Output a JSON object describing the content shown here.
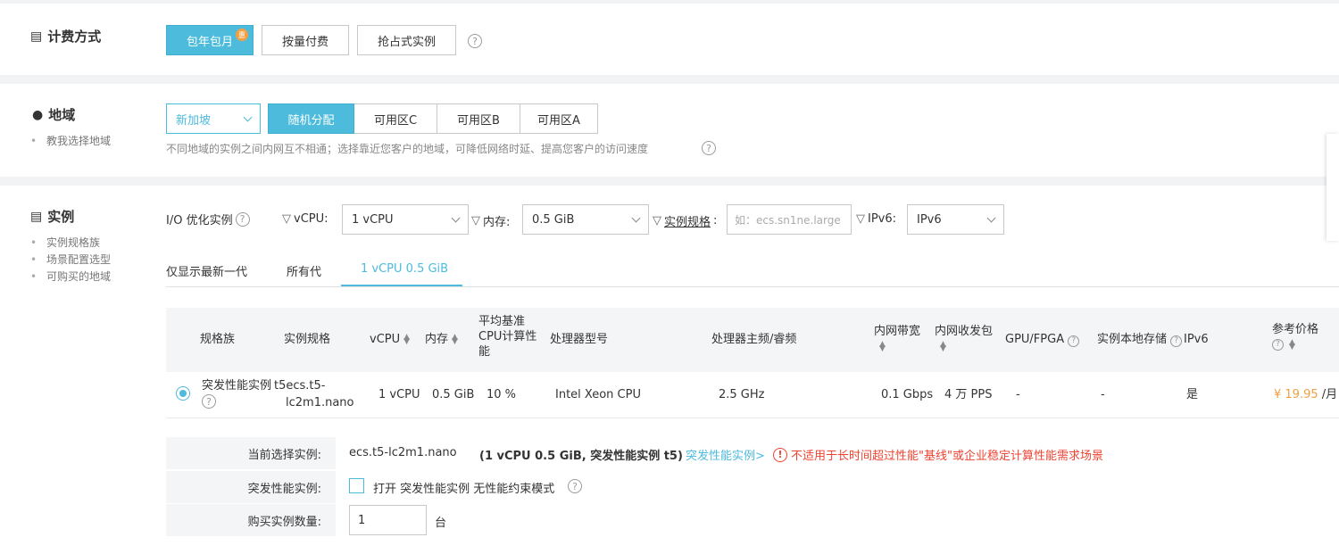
{
  "billing": {
    "title": "计费方式",
    "options": [
      "包年包月",
      "按量付费",
      "抢占式实例"
    ],
    "badge": "惠"
  },
  "region": {
    "title": "地域",
    "links": [
      "教我选择地域"
    ],
    "selected_region": "新加坡",
    "zones": [
      "随机分配",
      "可用区C",
      "可用区B",
      "可用区A"
    ],
    "hint": "不同地域的实例之间内网互不相通；选择靠近您客户的地域，可降低网络时延、提高您客户的访问速度"
  },
  "instance": {
    "title": "实例",
    "links": [
      "实例规格族",
      "场景配置选型",
      "可购买的地域"
    ],
    "io_label": "I/O 优化实例",
    "filters": {
      "vcpu_label": "vCPU:",
      "vcpu_value": "1 vCPU",
      "mem_label": "内存:",
      "mem_value": "0.5 GiB",
      "spec_label": "实例规格",
      "spec_placeholder": "如：ecs.sn1ne.large",
      "ipv6_label": "IPv6:",
      "ipv6_value": "IPv6"
    },
    "tabs": [
      "仅显示最新一代",
      "所有代",
      "1 vCPU 0.5 GiB"
    ],
    "columns": {
      "family": "规格族",
      "spec": "实例规格",
      "vcpu": "vCPU",
      "mem": "内存",
      "baseline_1": "平均基准",
      "baseline_2": "CPU计算性",
      "baseline_3": "能",
      "cpu_model": "处理器型号",
      "freq": "处理器主频/睿频",
      "bandwidth": "内网带宽",
      "pps": "内网收发包",
      "gpu": "GPU/FPGA",
      "local_storage": "实例本地存储",
      "ipv6": "IPv6",
      "price": "参考价格"
    },
    "row": {
      "family": "突发性能实例",
      "spec_1": "t5ecs.t5-",
      "spec_2": "lc2m1.nano",
      "vcpu": "1 vCPU",
      "mem": "0.5 GiB",
      "baseline": "10 %",
      "cpu_model": "Intel Xeon CPU",
      "freq": "2.5 GHz",
      "bandwidth": "0.1 Gbps",
      "pps": "4 万 PPS",
      "gpu": "-",
      "local_storage": "-",
      "ipv6": "是",
      "price": "¥ 19.95",
      "price_unit": " /月"
    },
    "summary": {
      "current_label": "当前选择实例:",
      "current_value": "ecs.t5-lc2m1.nano",
      "current_desc": "(1 vCPU 0.5 GiB, 突发性能实例 t5)",
      "burst_link": "突发性能实例>",
      "warning": "不适用于长时间超过性能\"基线\"或企业稳定计算性能需求场景",
      "burst_label": "突发性能实例:",
      "burst_checkbox": "打开 突发性能实例 无性能约束模式",
      "qty_label": "购买实例数量:",
      "qty_value": "1",
      "qty_unit": "台"
    }
  },
  "colors": {
    "accent": "#4cbbdc",
    "price": "#f39f40",
    "warning": "#e43"
  }
}
